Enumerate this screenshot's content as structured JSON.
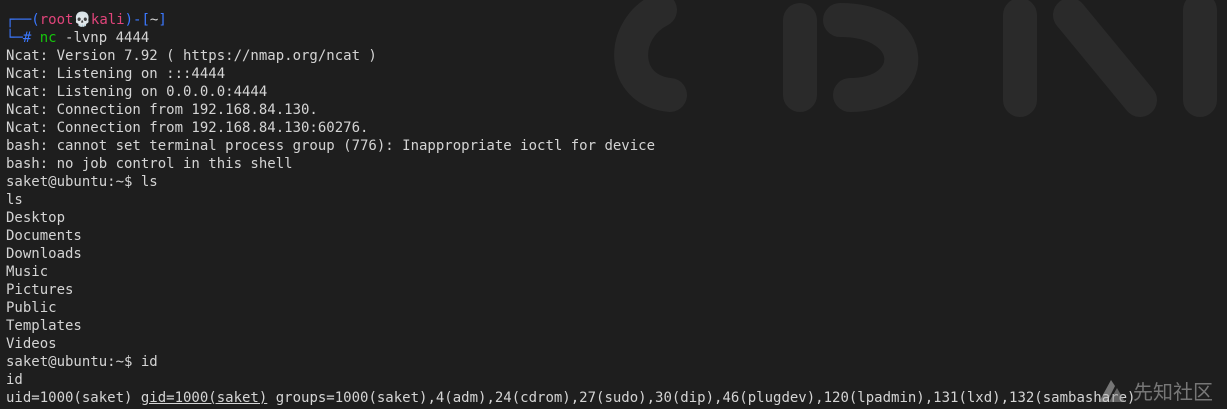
{
  "prompt": {
    "corner_top": "┌──",
    "corner_bottom": "└─",
    "user": "root",
    "skull": "💀",
    "host": "kali",
    "dir": "~",
    "symbol": "#",
    "cmd_name": "nc",
    "cmd_args": " -lvnp 4444"
  },
  "output_lines": [
    "Ncat: Version 7.92 ( https://nmap.org/ncat )",
    "Ncat: Listening on :::4444",
    "Ncat: Listening on 0.0.0.0:4444",
    "Ncat: Connection from 192.168.84.130.",
    "Ncat: Connection from 192.168.84.130:60276.",
    "bash: cannot set terminal process group (776): Inappropriate ioctl for device",
    "bash: no job control in this shell",
    "saket@ubuntu:~$ ls",
    "ls",
    "Desktop",
    "Documents",
    "Downloads",
    "Music",
    "Pictures",
    "Public",
    "Templates",
    "Videos",
    "saket@ubuntu:~$ id",
    "id"
  ],
  "id_line": {
    "uid": "uid=1000(saket) ",
    "gid": "gid=1000(saket)",
    "groups": " groups=1000(saket),4(adm),24(cdrom),27(sudo),30(dip),46(plugdev),120(lpadmin),131(lxd),132(sambashare)"
  },
  "watermark": {
    "text": "先知社区"
  },
  "colors": {
    "background": "#1e1e1e",
    "prompt_bracket": "#3b78ff",
    "prompt_user": "#e0447a",
    "command": "#16c60c",
    "text": "#d4d4d4"
  }
}
